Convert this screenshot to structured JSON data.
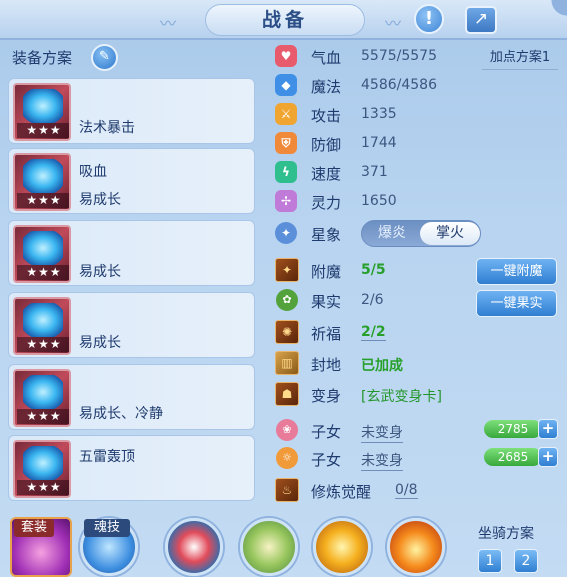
{
  "header": {
    "title": "战备",
    "help_icon": "exclamation-icon",
    "share_icon": "share-icon"
  },
  "equip_panel": {
    "label": "装备方案",
    "edit_icon": "pencil-icon",
    "items": [
      {
        "line1": "法术暴击",
        "line2": "",
        "stars": "★★★"
      },
      {
        "line1": "吸血",
        "line2": "易成长",
        "stars": "★★★"
      },
      {
        "line1": "易成长",
        "line2": "",
        "stars": "★★★"
      },
      {
        "line1": "易成长",
        "line2": "",
        "stars": "★★★"
      },
      {
        "line1": "易成长、冷静",
        "line2": "",
        "stars": "★★★"
      },
      {
        "line1": "五雷轰顶",
        "line2": "",
        "stars": "★★★"
      }
    ]
  },
  "stats": {
    "add_plan": "加点方案1",
    "rows": [
      {
        "name": "气血",
        "value": "5575/5575",
        "color": "#e85b6c"
      },
      {
        "name": "魔法",
        "value": "4586/4586",
        "color": "#3f8fe6"
      },
      {
        "name": "攻击",
        "value": "1335",
        "color": "#f0a531"
      },
      {
        "name": "防御",
        "value": "1744",
        "color": "#f08a3a"
      },
      {
        "name": "速度",
        "value": "371",
        "color": "#2fbf8f"
      },
      {
        "name": "灵力",
        "value": "1650",
        "color": "#c07ad8"
      }
    ],
    "star": {
      "name": "星象",
      "option_a": "爆炎",
      "option_b": "掌火"
    }
  },
  "extras": {
    "enchant": {
      "name": "附魔",
      "value": "5/5",
      "button": "一键附魔"
    },
    "fruit": {
      "name": "果实",
      "value": "2/6",
      "button": "一键果实"
    },
    "blessing": {
      "name": "祈福",
      "value": "2/2"
    },
    "seal": {
      "name": "封地",
      "value": "已加成"
    },
    "transform": {
      "name": "变身",
      "value": "[玄武变身卡]"
    },
    "child1": {
      "name": "子女",
      "value": "未变身",
      "points": "2785"
    },
    "child2": {
      "name": "子女",
      "value": "未变身",
      "points": "2685"
    },
    "awaken": {
      "name": "修炼觉醒",
      "value": "0/8"
    }
  },
  "bottom": {
    "set_label": "套装",
    "soul_label": "魂技",
    "mount_label": "坐骑方案",
    "mount_1": "1",
    "mount_2": "2"
  }
}
